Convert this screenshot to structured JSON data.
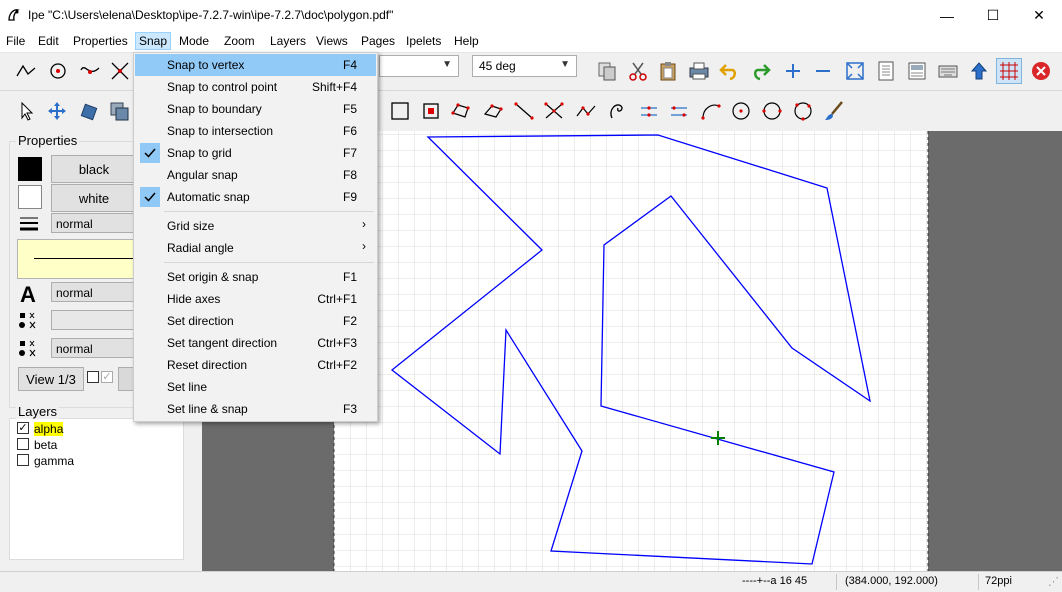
{
  "window": {
    "title": "Ipe \"C:\\Users\\elena\\Desktop\\ipe-7.2.7-win\\ipe-7.2.7\\doc\\polygon.pdf\"",
    "minimize": "—",
    "maximize": "☐",
    "close": "✕"
  },
  "menubar": [
    "File",
    "Edit",
    "Properties",
    "Snap",
    "Mode",
    "Zoom",
    "Layers",
    "Views",
    "Pages",
    "Ipelets",
    "Help"
  ],
  "toolbar": {
    "angle_combo": "45 deg"
  },
  "properties": {
    "title": "Properties",
    "stroke_color": "black",
    "fill_color": "white",
    "pen": "normal",
    "text_size": "normal",
    "symbol_size": "normal",
    "view_label": "View 1/3"
  },
  "layers": {
    "title": "Layers",
    "items": [
      {
        "name": "alpha",
        "checked": true,
        "highlighted": true
      },
      {
        "name": "beta",
        "checked": false,
        "highlighted": false
      },
      {
        "name": "gamma",
        "checked": false,
        "highlighted": false
      }
    ]
  },
  "snap_menu": {
    "items": [
      {
        "label": "Snap to vertex",
        "shortcut": "F4",
        "checked": false,
        "highlighted": true
      },
      {
        "label": "Snap to control point",
        "shortcut": "Shift+F4",
        "checked": false
      },
      {
        "label": "Snap to boundary",
        "shortcut": "F5",
        "checked": false
      },
      {
        "label": "Snap to intersection",
        "shortcut": "F6",
        "checked": false
      },
      {
        "label": "Snap to grid",
        "shortcut": "F7",
        "checked": true
      },
      {
        "label": "Angular snap",
        "shortcut": "F8",
        "checked": false
      },
      {
        "label": "Automatic snap",
        "shortcut": "F9",
        "checked": true
      }
    ],
    "submenus": [
      {
        "label": "Grid size",
        "arrow": "›"
      },
      {
        "label": "Radial angle",
        "arrow": "›"
      }
    ],
    "items2": [
      {
        "label": "Set origin & snap",
        "shortcut": "F1"
      },
      {
        "label": "Hide axes",
        "shortcut": "Ctrl+F1"
      },
      {
        "label": "Set direction",
        "shortcut": "F2"
      },
      {
        "label": "Set tangent direction",
        "shortcut": "Ctrl+F3"
      },
      {
        "label": "Reset direction",
        "shortcut": "Ctrl+F2"
      },
      {
        "label": "Set line",
        "shortcut": ""
      },
      {
        "label": "Set line & snap",
        "shortcut": "F3"
      }
    ]
  },
  "status": {
    "snap_indicator": "----+--a 16 45",
    "coords": "(384.000, 192.000)",
    "resolution": "72ppi"
  },
  "colors": {
    "polygon_stroke": "#0000ff",
    "cursor": "#008000",
    "highlight": "#91c9f7",
    "layer_highlight": "#ffff00"
  }
}
